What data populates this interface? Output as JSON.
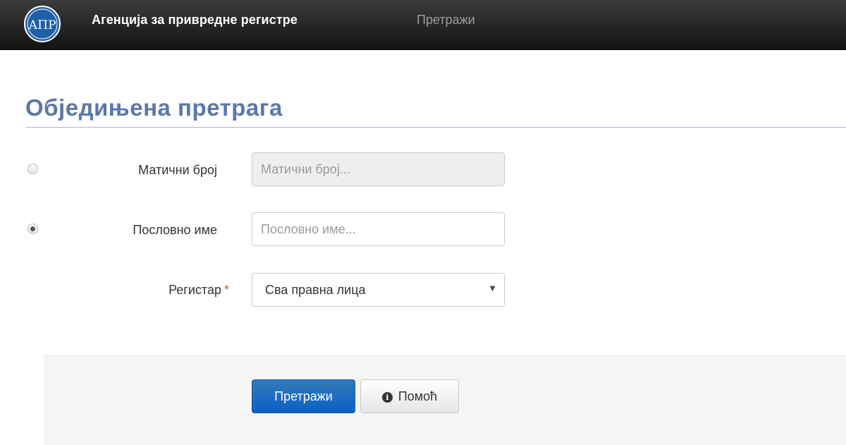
{
  "navbar": {
    "brand": "Агенција за привредне регистре",
    "link": "Претражи",
    "logo_text": "АПР"
  },
  "page": {
    "title": "Обједињена претрага"
  },
  "form": {
    "registration_number": {
      "label": "Матични број",
      "placeholder": "Матични број...",
      "selected": false
    },
    "business_name": {
      "label": "Пословно име",
      "placeholder": "Пословно име...",
      "selected": true
    },
    "register": {
      "label": "Регистар",
      "required_mark": "*",
      "value": "Сва правна лица"
    }
  },
  "actions": {
    "search_label": "Претражи",
    "help_label": "Помоћ"
  },
  "colors": {
    "navbar": "#222222",
    "title": "#5b78a8",
    "primary": "#0c60c8",
    "required": "#d9534f"
  },
  "icons": {
    "help": "info-circle-icon",
    "select": "caret-down-icon"
  }
}
